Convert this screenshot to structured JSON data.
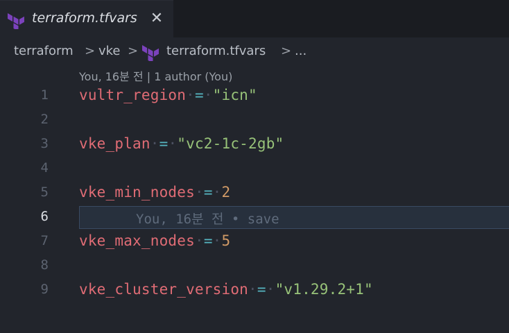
{
  "tab": {
    "title": "terraform.tfvars",
    "close_glyph": "✕"
  },
  "breadcrumb": {
    "items": [
      "terraform",
      "vke",
      "terraform.tfvars",
      "..."
    ],
    "separator": ">"
  },
  "blame_header": "You, 16분 전 | 1 author (You)",
  "lines": [
    {
      "num": "1",
      "key": "vultr_region",
      "value": "\"icn\"",
      "value_type": "string"
    },
    {
      "num": "2"
    },
    {
      "num": "3",
      "key": "vke_plan",
      "value": "\"vc2-1c-2gb\"",
      "value_type": "string"
    },
    {
      "num": "4"
    },
    {
      "num": "5",
      "key": "vke_min_nodes",
      "value": "2",
      "value_type": "number"
    },
    {
      "num": "6",
      "ghost": "You, 16분 전 • save"
    },
    {
      "num": "7",
      "key": "vke_max_nodes",
      "value": "5",
      "value_type": "number"
    },
    {
      "num": "8"
    },
    {
      "num": "9",
      "key": "vke_cluster_version",
      "value": "\"v1.29.2+1\"",
      "value_type": "string"
    }
  ],
  "tokens": {
    "ws": "·",
    "eq": "="
  },
  "icons": {
    "file_icon": "terraform-icon",
    "close": "close-icon"
  },
  "colors": {
    "background": "#22252c",
    "key": "#e06c75",
    "equals": "#56b6c2",
    "string": "#98c379",
    "number": "#d19a66",
    "terraform_brand": "#7b42bc"
  }
}
